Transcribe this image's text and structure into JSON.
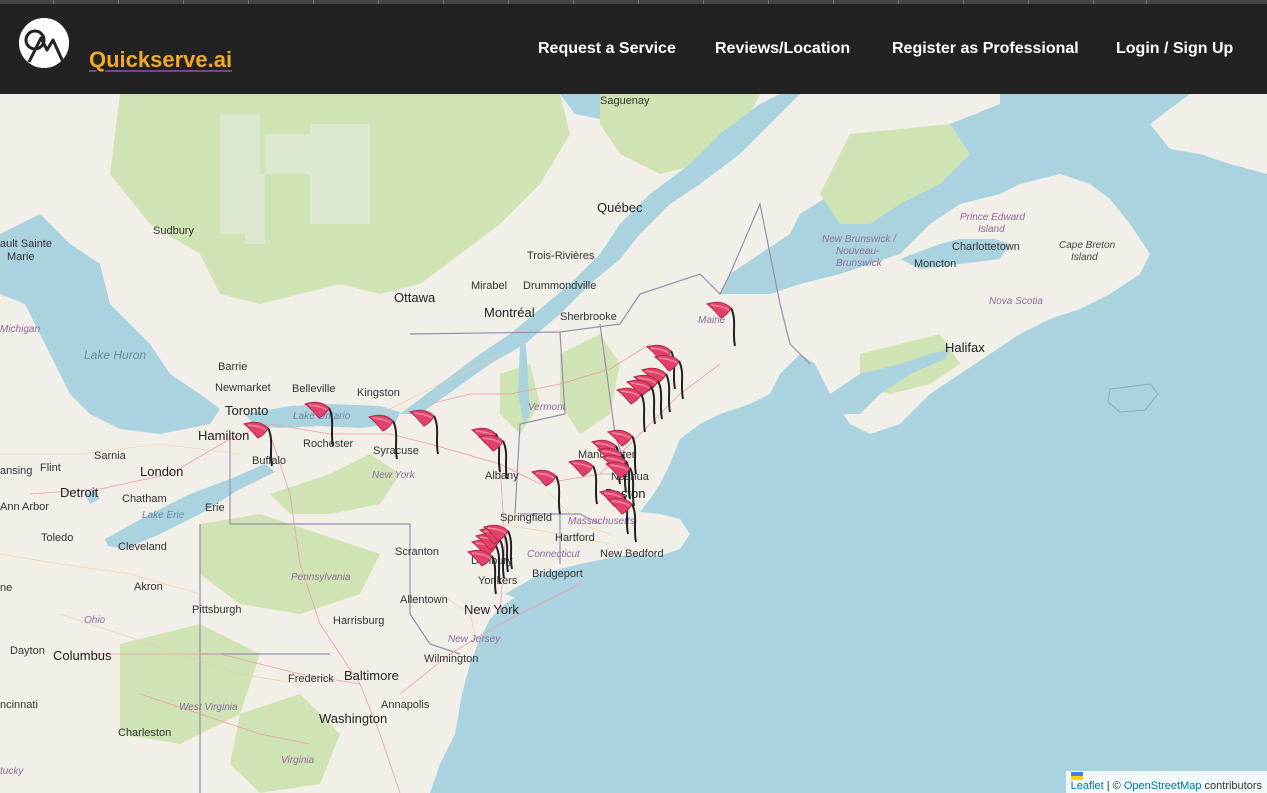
{
  "navbar": {
    "brand": "Quickserve.ai",
    "links": [
      "Request a Service",
      "Reviews/Location",
      "Register as Professional",
      "Login / Sign Up"
    ]
  },
  "map": {
    "labels": {
      "saguenay": "Saguenay",
      "quebec": "Québec",
      "sudbury": "Sudbury",
      "sault": "ault Sainte",
      "marie": "Marie",
      "trois": "Trois-Rivières",
      "mirabel": "Mirabel",
      "drummondville": "Drummondville",
      "ottawa": "Ottawa",
      "montreal": "Montréal",
      "sherbrooke": "Sherbrooke",
      "michigan": "Michigan",
      "lake_huron": "Lake Huron",
      "barrie": "Barrie",
      "newmarket": "Newmarket",
      "belleville": "Belleville",
      "kingston": "Kingston",
      "toronto": "Toronto",
      "lake_ontario": "Lake Ontario",
      "hamilton": "Hamilton",
      "rochester": "Rochester",
      "syracuse": "Syracuse",
      "vermont": "Vermont",
      "buffalo": "Buffalo",
      "sarnia": "Sarnia",
      "lansing": "ansing",
      "flint": "Flint",
      "london": "London",
      "new_york_state": "New York",
      "albany": "Albany",
      "manchester": "Manchester",
      "nashua": "Nashua",
      "boston": "Boston",
      "detroit": "Detroit",
      "chatham": "Chatham",
      "ann_arbor": "Ann Arbor",
      "lake_erie": "Lake Erie",
      "erie": "Erie",
      "springfield": "Springfield",
      "massachusetts": "Massachusetts",
      "toledo": "Toledo",
      "cleveland": "Cleveland",
      "hartford": "Hartford",
      "new_bedford": "New Bedford",
      "scranton": "Scranton",
      "connecticut": "Connecticut",
      "danbury": "Danbury",
      "akron": "Akron",
      "pennsylvania": "Pennsylvania",
      "bridgeport": "Bridgeport",
      "yonkers": "Yonkers",
      "ne": "ne",
      "pittsburgh": "Pittsburgh",
      "allentown": "Allentown",
      "new_york_city": "New York",
      "ohio": "Ohio",
      "harrisburg": "Harrisburg",
      "new_jersey": "New Jersey",
      "dayton": "Dayton",
      "columbus": "Columbus",
      "wilmington": "Wilmington",
      "frederick": "Frederick",
      "baltimore": "Baltimore",
      "cincinnati": "ncinnati",
      "west_virginia": "West Virginia",
      "annapolis": "Annapolis",
      "washington": "Washington",
      "charleston": "Charleston",
      "virginia": "Virginia",
      "kentucky": "tucky",
      "maine": "Maine",
      "new_brunswick_1": "New Brunswick /",
      "new_brunswick_2": "Nouveau-",
      "new_brunswick_3": "Brunswick",
      "moncton": "Moncton",
      "pei_1": "Prince Edward",
      "pei_2": "Island",
      "charlottetown": "Charlottetown",
      "cape_breton_1": "Cape Breton",
      "cape_breton_2": "Island",
      "nova_scotia": "Nova Scotia",
      "halifax": "Halifax"
    },
    "marker_count": 30
  },
  "attribution": {
    "leaflet": "Leaflet",
    "separator": " | © ",
    "osm": "OpenStreetMap",
    "suffix": " contributors"
  },
  "colors": {
    "navbar_bg": "#222222",
    "brand": "#f0a92b",
    "water": "#aad3df",
    "land": "#f2efe9",
    "forest": "#cfe3b4",
    "marker": "#e2426a"
  }
}
